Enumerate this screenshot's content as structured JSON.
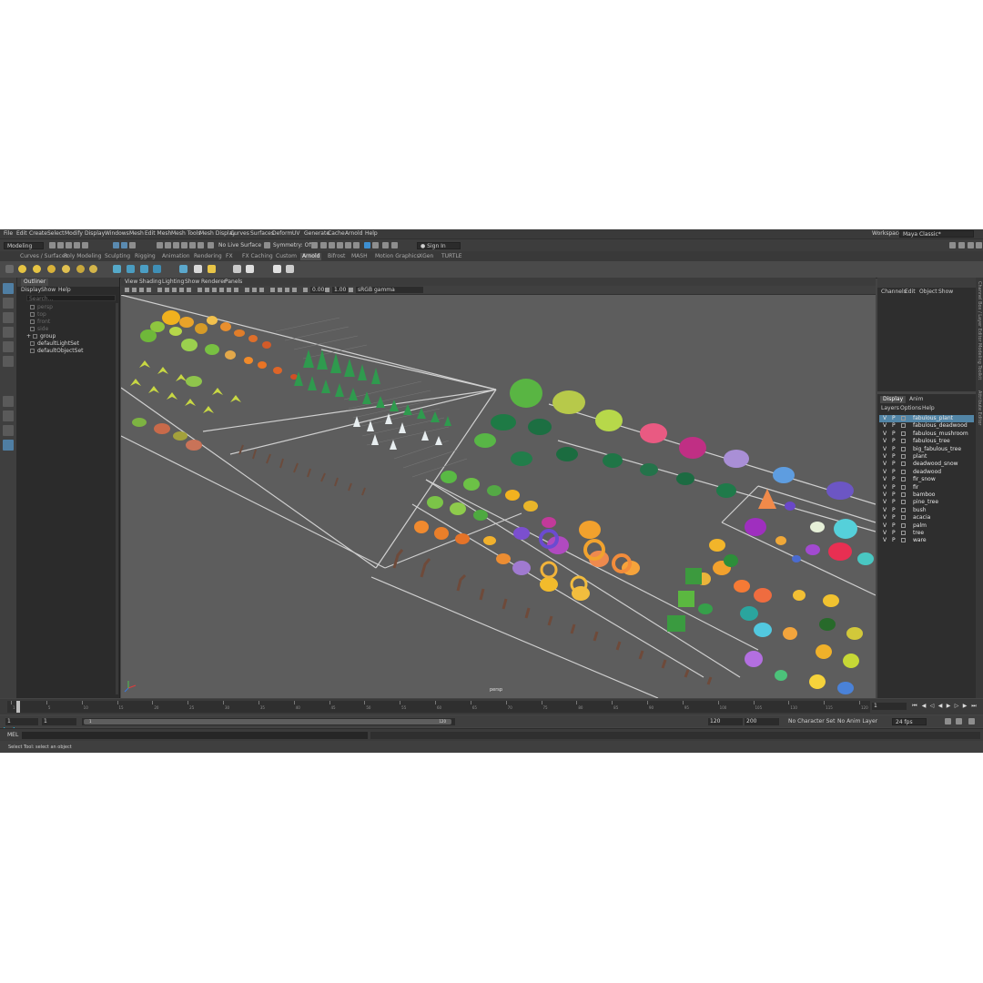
{
  "menubar": {
    "items": [
      "File",
      "Edit",
      "Create",
      "Select",
      "Modify",
      "Display",
      "Windows",
      "Mesh",
      "Edit Mesh",
      "Mesh Tools",
      "Mesh Display",
      "Curves",
      "Surfaces",
      "Deform",
      "UV",
      "Generate",
      "Cache",
      "Arnold",
      "Help"
    ],
    "workspace_label": "Workspace :",
    "workspace_value": "Maya Classic*"
  },
  "statusline": {
    "mode": "Modeling",
    "live_surface": "No Live Surface",
    "symmetry": "Symmetry: Off",
    "sign_in": "Sign In"
  },
  "shelf_tabs": [
    "Curves / Surfaces",
    "Poly Modeling",
    "Sculpting",
    "Rigging",
    "Animation",
    "Rendering",
    "FX",
    "FX Caching",
    "Custom",
    "Arnold",
    "Bifrost",
    "MASH",
    "Motion Graphics",
    "XGen",
    "TURTLE"
  ],
  "active_shelf_tab": "Arnold",
  "outliner": {
    "tab": "Outliner",
    "menus": [
      "Display",
      "Show",
      "Help"
    ],
    "search_placeholder": "Search...",
    "items": [
      {
        "label": "persp",
        "dim": true
      },
      {
        "label": "top",
        "dim": true
      },
      {
        "label": "front",
        "dim": true
      },
      {
        "label": "side",
        "dim": true
      },
      {
        "label": "group",
        "dim": false
      },
      {
        "label": "defaultLightSet",
        "dim": false
      },
      {
        "label": "defaultObjectSet",
        "dim": false
      }
    ]
  },
  "viewport": {
    "menus": [
      "View",
      "Shading",
      "Lighting",
      "Show",
      "Renderer",
      "Panels"
    ],
    "exposure": "0.00",
    "gamma": "1.00",
    "colorspace": "sRGB gamma",
    "camera": "persp"
  },
  "channelbox": {
    "menus": [
      "Channels",
      "Edit",
      "Object",
      "Show"
    ]
  },
  "layer_editor": {
    "tabs": [
      "Display",
      "Anim"
    ],
    "menus": [
      "Layers",
      "Options",
      "Help"
    ],
    "layers": [
      {
        "v": "V",
        "p": "P",
        "name": "fabulous_plant",
        "selected": true
      },
      {
        "v": "V",
        "p": "P",
        "name": "fabulous_deadwood",
        "selected": false
      },
      {
        "v": "V",
        "p": "P",
        "name": "fabulous_mushroom",
        "selected": false
      },
      {
        "v": "V",
        "p": "P",
        "name": "fabulous_tree",
        "selected": false
      },
      {
        "v": "V",
        "p": "P",
        "name": "big_fabulous_tree",
        "selected": false
      },
      {
        "v": "V",
        "p": "P",
        "name": "plant",
        "selected": false
      },
      {
        "v": "V",
        "p": "P",
        "name": "deadwood_snow",
        "selected": false
      },
      {
        "v": "V",
        "p": "P",
        "name": "deadwood",
        "selected": false
      },
      {
        "v": "V",
        "p": "P",
        "name": "fir_snow",
        "selected": false
      },
      {
        "v": "V",
        "p": "P",
        "name": "fir",
        "selected": false
      },
      {
        "v": "V",
        "p": "P",
        "name": "bamboo",
        "selected": false
      },
      {
        "v": "V",
        "p": "P",
        "name": "pine_tree",
        "selected": false
      },
      {
        "v": "V",
        "p": "P",
        "name": "bush",
        "selected": false
      },
      {
        "v": "V",
        "p": "P",
        "name": "acacia",
        "selected": false
      },
      {
        "v": "V",
        "p": "P",
        "name": "palm",
        "selected": false
      },
      {
        "v": "V",
        "p": "P",
        "name": "tree",
        "selected": false
      },
      {
        "v": "V",
        "p": "P",
        "name": "ware",
        "selected": false
      }
    ]
  },
  "side_strip": [
    "Channel Box / Layer Editor",
    "Modeling Toolkit",
    "Attribute Editor"
  ],
  "timeslider": {
    "current_frame": "1",
    "ticks": [
      "1",
      "5",
      "10",
      "15",
      "20",
      "25",
      "30",
      "35",
      "40",
      "45",
      "50",
      "55",
      "60",
      "65",
      "70",
      "75",
      "80",
      "85",
      "90",
      "95",
      "100",
      "105",
      "110",
      "115",
      "120"
    ]
  },
  "rangeslider": {
    "start": "1",
    "anim_start": "1",
    "range_start_label": "1",
    "range_end_label": "120",
    "end": "120",
    "anim_end": "200",
    "character_set": "No Character Set",
    "anim_layer": "No Anim Layer",
    "fps": "24 fps"
  },
  "cmdline": {
    "label": "MEL"
  },
  "helpline": {
    "text": "Select Tool: select an object"
  },
  "colors": {
    "app_bg": "#444444",
    "viewport_bg": "#5d5d5d",
    "selection": "#5285a6",
    "maya_logo": "#2aa7c9"
  }
}
